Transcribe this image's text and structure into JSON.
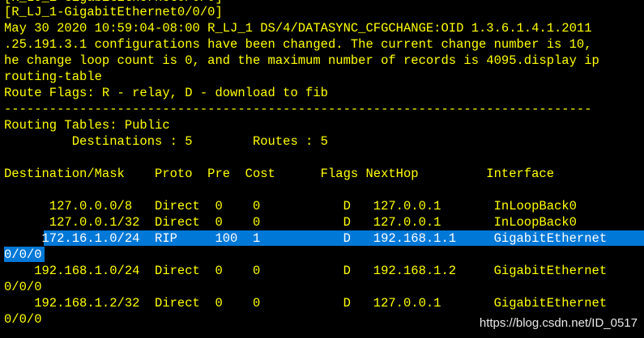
{
  "terminal": {
    "lines": [
      "[R_LJ_1-GigabitEthernet0/0/0]",
      "May 30 2020 10:59:04-08:00 R_LJ_1 DS/4/DATASYNC_CFGCHANGE:OID 1.3.6.1.4.1.2011",
      ".25.191.3.1 configurations have been changed. The current change number is 10,",
      "he change loop count is 0, and the maximum number of records is 4095.display ip",
      "routing-table",
      "Route Flags: R - relay, D - download to fib",
      "------------------------------------------------------------------------------",
      "Routing Tables: Public",
      "         Destinations : 5        Routes : 5",
      "",
      "Destination/Mask    Proto  Pre  Cost      Flags NextHop         Interface",
      "",
      "      127.0.0.0/8   Direct  0    0           D   127.0.0.1       InLoopBack0",
      "      127.0.0.1/32  Direct  0    0           D   127.0.0.1       InLoopBack0",
      "     172.16.1.0/24  RIP     100  1           D   192.168.1.1     GigabitEthernet",
      "0/0/0",
      "    192.168.1.0/24  Direct  0    0           D   192.168.1.2     GigabitEthernet",
      "0/0/0",
      "    192.168.1.2/32  Direct  0    0           D   127.0.0.1       GigabitEthernet",
      "0/0/0"
    ],
    "selected_line_index": 14,
    "colors": {
      "background": "#000000",
      "text": "#ffff00",
      "selection": "#0078d7",
      "selection_text": "#ffffff"
    }
  },
  "watermark": {
    "text": "https://blog.csdn.net/ID_0517"
  }
}
